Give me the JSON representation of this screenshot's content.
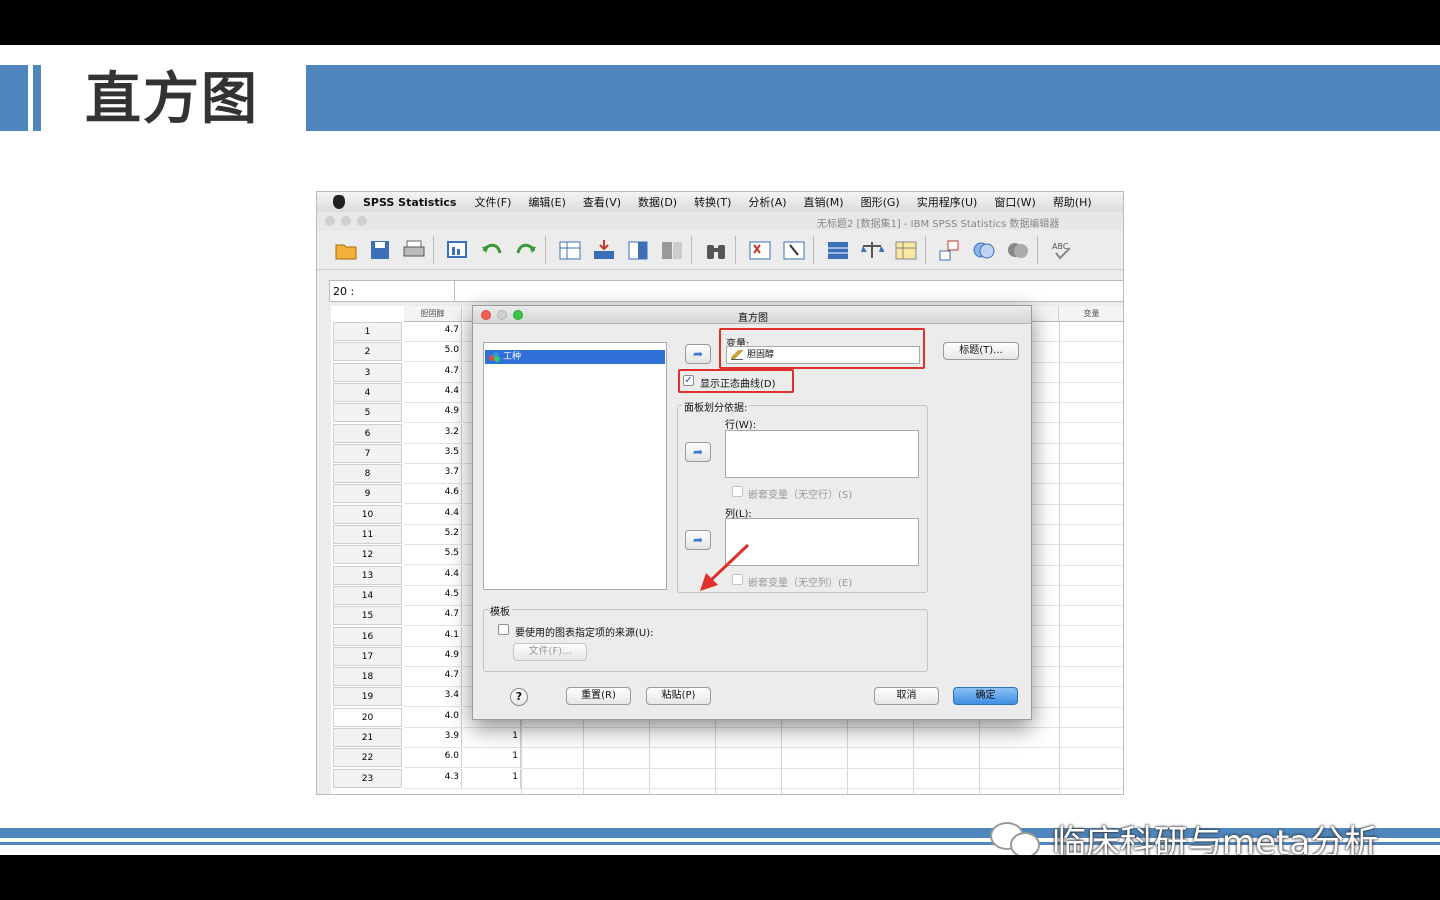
{
  "slide": {
    "title": "直方图",
    "watermark": "临床科研与meta分析"
  },
  "menubar": {
    "app_name": "SPSS Statistics",
    "items": [
      "文件(F)",
      "编辑(E)",
      "查看(V)",
      "数据(D)",
      "转换(T)",
      "分析(A)",
      "直销(M)",
      "图形(G)",
      "实用程序(U)",
      "窗口(W)",
      "帮助(H)"
    ]
  },
  "window": {
    "title": "无标题2 [数据集1] - IBM SPSS Statistics 数据编辑器"
  },
  "cell_ref": "20 :",
  "grid": {
    "columns": [
      "胆固醇",
      "变量"
    ],
    "rows": [
      {
        "n": "1",
        "v1": "4.7",
        "v2": ""
      },
      {
        "n": "2",
        "v1": "5.0",
        "v2": ""
      },
      {
        "n": "3",
        "v1": "4.7",
        "v2": ""
      },
      {
        "n": "4",
        "v1": "4.4",
        "v2": ""
      },
      {
        "n": "5",
        "v1": "4.9",
        "v2": ""
      },
      {
        "n": "6",
        "v1": "3.2",
        "v2": ""
      },
      {
        "n": "7",
        "v1": "3.5",
        "v2": ""
      },
      {
        "n": "8",
        "v1": "3.7",
        "v2": ""
      },
      {
        "n": "9",
        "v1": "4.6",
        "v2": ""
      },
      {
        "n": "10",
        "v1": "4.4",
        "v2": ""
      },
      {
        "n": "11",
        "v1": "5.2",
        "v2": ""
      },
      {
        "n": "12",
        "v1": "5.5",
        "v2": ""
      },
      {
        "n": "13",
        "v1": "4.4",
        "v2": ""
      },
      {
        "n": "14",
        "v1": "4.5",
        "v2": ""
      },
      {
        "n": "15",
        "v1": "4.7",
        "v2": ""
      },
      {
        "n": "16",
        "v1": "4.1",
        "v2": ""
      },
      {
        "n": "17",
        "v1": "4.9",
        "v2": ""
      },
      {
        "n": "18",
        "v1": "4.7",
        "v2": ""
      },
      {
        "n": "19",
        "v1": "3.4",
        "v2": ""
      },
      {
        "n": "20",
        "v1": "4.0",
        "v2": ""
      },
      {
        "n": "21",
        "v1": "3.9",
        "v2": "1"
      },
      {
        "n": "22",
        "v1": "6.0",
        "v2": "1"
      },
      {
        "n": "23",
        "v1": "4.3",
        "v2": "1"
      }
    ]
  },
  "dialog": {
    "title": "直方图",
    "source_item": "工种",
    "variable_label": "变量:",
    "variable_value": "胆固醇",
    "title_button": "标题(T)...",
    "normal_curve_label": "显示正态曲线(D)",
    "normal_curve_checked": true,
    "panel_label": "面板划分依据:",
    "rows_label": "行(W):",
    "nest_rows_label": "嵌套变量（无空行）(S)",
    "cols_label": "列(L):",
    "nest_cols_label": "嵌套变量（无空列）(E)",
    "template_label": "模板",
    "template_checkbox_label": "要使用的图表指定项的来源(U):",
    "file_button": "文件(F)...",
    "help_button": "?",
    "reset_button": "重置(R)",
    "paste_button": "粘贴(P)",
    "cancel_button": "取消",
    "ok_button": "确定"
  },
  "colors": {
    "band_blue": "#4f86bd",
    "highlight_red": "#e0302c",
    "selection_blue": "#2f6fd8"
  }
}
